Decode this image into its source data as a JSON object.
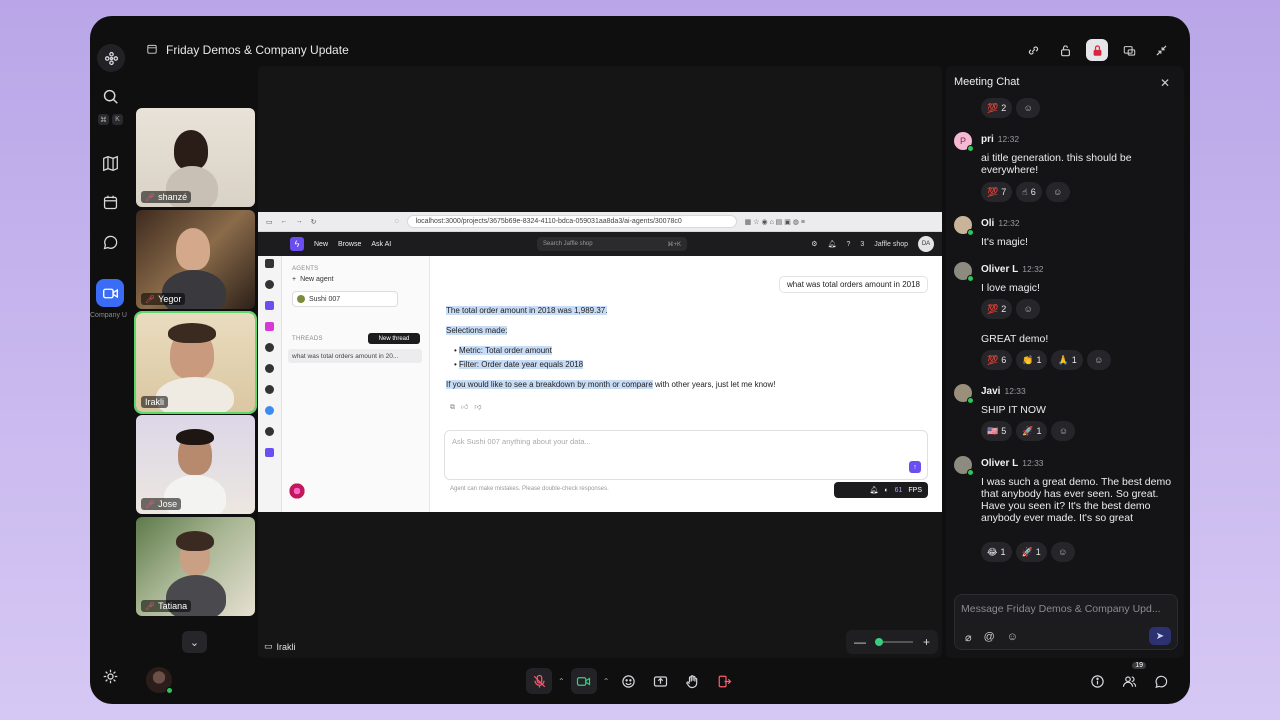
{
  "window": {
    "title": "Friday Demos & Company Update"
  },
  "rail": {
    "kbd_cmd": "⌘",
    "kbd_k": "K",
    "active_caption": "Company U"
  },
  "participants": [
    {
      "name": "shanzé",
      "muted": true
    },
    {
      "name": "Yegor",
      "muted": true
    },
    {
      "name": "Irakli",
      "muted": false,
      "speaking": true
    },
    {
      "name": "Jose",
      "muted": true
    },
    {
      "name": "Tatiana",
      "muted": true
    }
  ],
  "stage": {
    "presenter_label": "Irakli",
    "zoom_minus": "—",
    "zoom_plus": "+"
  },
  "shared_screen": {
    "url": "localhost:3000/projects/3675b69e-8324-4110-bdca-059031aa8da3/ai-agents/30078c0",
    "nav": {
      "new": "New",
      "browse": "Browse",
      "ask_ai": "Ask AI"
    },
    "search_placeholder": "Search Jaffle shop",
    "search_shortcut": "⌘+K",
    "notif_count": "3",
    "project": "Jaffle shop",
    "user_initials": "DA",
    "agents_label": "AGENTS",
    "new_agent": "New agent",
    "agent_name": "Sushi 007",
    "threads_label": "THREADS",
    "new_thread": "New thread",
    "thread_item": "what was total orders amount in 20...",
    "user_question": "what was total orders amount in 2018",
    "answer_line1": "The total order amount in 2018 was 1,989.37.",
    "answer_line2": "Selections made:",
    "bullet1": "Metric: Total order amount",
    "bullet2": "Filter: Order date year equals 2018",
    "answer_line3_highlight": "If you would like to see a breakdown by month or compare",
    "answer_line3_rest": " with other years, just let me know!",
    "ask_placeholder": "Ask Sushi 007 anything about your data...",
    "disclaimer": "Agent can make mistakes. Please double-check responses.",
    "fps_value": "61",
    "fps_label": "FPS"
  },
  "chat": {
    "title": "Meeting Chat",
    "input_placeholder": "Message Friday Demos & Company Upd...",
    "messages": [
      {
        "reacts": [
          {
            "emoji": "💯",
            "count": "2"
          }
        ]
      },
      {
        "author": "pri",
        "time": "12:32",
        "initial": "P",
        "text": "ai title generation. this should be everywhere!",
        "reacts": [
          {
            "emoji": "💯",
            "count": "7"
          },
          {
            "emoji": "☝",
            "count": "6"
          }
        ]
      },
      {
        "author": "Oli",
        "time": "12:32",
        "text": "It's magic!"
      },
      {
        "author": "Oliver L",
        "time": "12:32",
        "text": "I love magic!",
        "text2": "GREAT demo!",
        "reacts": [
          {
            "emoji": "💯",
            "count": "2"
          }
        ],
        "reacts2": [
          {
            "emoji": "💯",
            "count": "6"
          },
          {
            "emoji": "👏",
            "count": "1"
          },
          {
            "emoji": "🙏",
            "count": "1"
          }
        ]
      },
      {
        "author": "Javi",
        "time": "12:33",
        "text": "SHIP IT NOW",
        "reacts": [
          {
            "emoji": "🇺🇸",
            "count": "5"
          },
          {
            "emoji": "🚀",
            "count": "1"
          }
        ]
      },
      {
        "author": "Oliver L",
        "time": "12:33",
        "text": "I was such a great demo. The best demo that anybody has ever seen. So great. Have you seen it? It's the best demo anybody ever made. It's so great",
        "reacts": [
          {
            "emoji": "😂",
            "count": "1"
          },
          {
            "emoji": "🚀",
            "count": "1"
          }
        ]
      }
    ]
  },
  "bottom": {
    "people_count": "19"
  },
  "colors": {
    "accent": "#3b6cf6",
    "speaking": "#5dd86a",
    "muted": "#ff5a6e",
    "brand_purple": "#6b4ef0"
  }
}
